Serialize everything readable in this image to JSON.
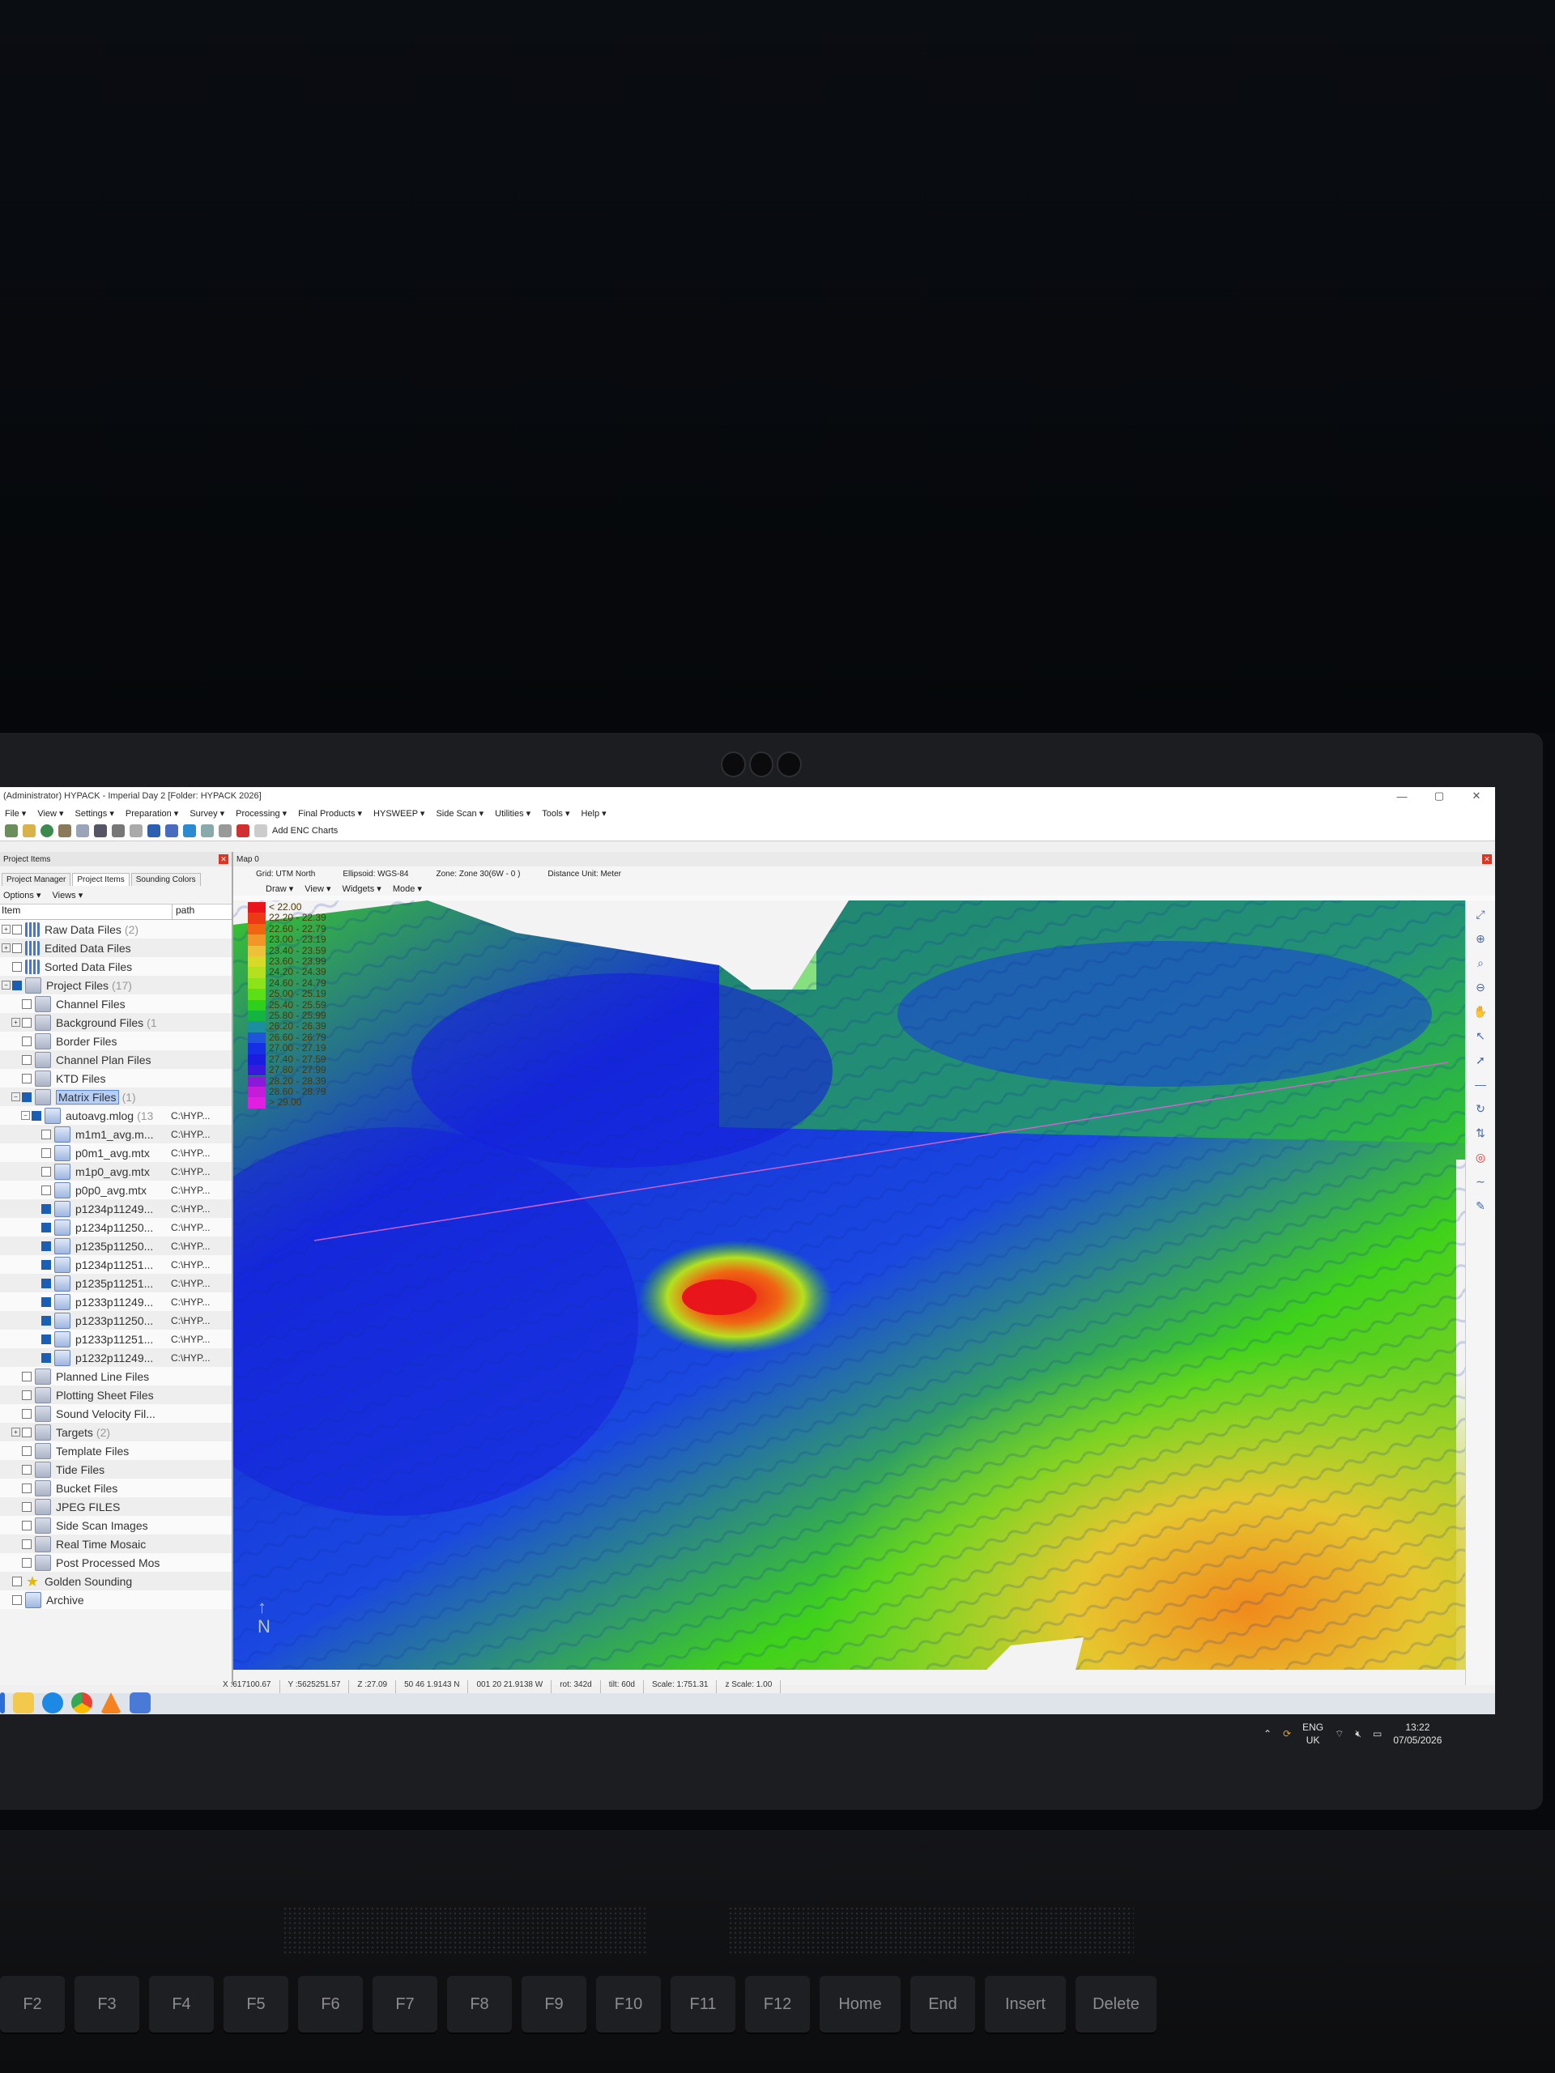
{
  "window": {
    "title": "(Administrator) HYPACK - Imperial Day 2 [Folder: HYPACK 2026]",
    "minimize": "—",
    "maximize": "▢",
    "close": "✕"
  },
  "menu": [
    "File ▾",
    "View ▾",
    "Settings ▾",
    "Preparation ▾",
    "Survey ▾",
    "Processing ▾",
    "Final Products ▾",
    "HYSWEEP ▾",
    "Side Scan ▾",
    "Utilities ▾",
    "Tools ▾",
    "Help ▾"
  ],
  "toolbar": {
    "add_enc": "Add ENC Charts"
  },
  "left_panel": {
    "title": "Project Items",
    "tabs": [
      "Project Manager",
      "Project Items",
      "Sounding Colors"
    ],
    "options": "Options ▾",
    "views": "Views ▾",
    "col_item": "Item",
    "col_path": "path",
    "tree": [
      {
        "name": "Raw Data Files",
        "count": "(2)",
        "level": 0,
        "icon": "grid",
        "exp": "+"
      },
      {
        "name": "Edited Data Files",
        "count": "",
        "level": 0,
        "icon": "grid",
        "exp": "+"
      },
      {
        "name": "Sorted Data Files",
        "count": "",
        "level": 0,
        "icon": "grid",
        "exp": ""
      },
      {
        "name": "Project Files",
        "count": "(17)",
        "level": 0,
        "icon": "folder",
        "exp": "−",
        "checked": true
      },
      {
        "name": "Channel Files",
        "count": "",
        "level": 1,
        "icon": "folder",
        "exp": ""
      },
      {
        "name": "Background Files",
        "count": "(1",
        "level": 1,
        "icon": "folder",
        "exp": "+"
      },
      {
        "name": "Border Files",
        "count": "",
        "level": 1,
        "icon": "folder",
        "exp": ""
      },
      {
        "name": "Channel Plan Files",
        "count": "",
        "level": 1,
        "icon": "folder",
        "exp": ""
      },
      {
        "name": "KTD Files",
        "count": "",
        "level": 1,
        "icon": "folder",
        "exp": ""
      },
      {
        "name": "Matrix Files",
        "count": "(1)",
        "level": 1,
        "icon": "folder",
        "exp": "−",
        "checked": true,
        "selected": true
      },
      {
        "name": "autoavg.mlog",
        "count": "(13",
        "level": 2,
        "icon": "file",
        "exp": "−",
        "checked": true,
        "path": "C:\\HYP..."
      },
      {
        "name": "m1m1_avg.m...",
        "count": "",
        "level": 3,
        "icon": "file",
        "exp": "",
        "path": "C:\\HYP..."
      },
      {
        "name": "p0m1_avg.mtx",
        "count": "",
        "level": 3,
        "icon": "file",
        "exp": "",
        "path": "C:\\HYP..."
      },
      {
        "name": "m1p0_avg.mtx",
        "count": "",
        "level": 3,
        "icon": "file",
        "exp": "",
        "path": "C:\\HYP..."
      },
      {
        "name": "p0p0_avg.mtx",
        "count": "",
        "level": 3,
        "icon": "file",
        "exp": "",
        "path": "C:\\HYP..."
      },
      {
        "name": "p1234p11249...",
        "count": "",
        "level": 3,
        "icon": "file",
        "exp": "",
        "checked": true,
        "path": "C:\\HYP..."
      },
      {
        "name": "p1234p11250...",
        "count": "",
        "level": 3,
        "icon": "file",
        "exp": "",
        "checked": true,
        "path": "C:\\HYP..."
      },
      {
        "name": "p1235p11250...",
        "count": "",
        "level": 3,
        "icon": "file",
        "exp": "",
        "checked": true,
        "path": "C:\\HYP..."
      },
      {
        "name": "p1234p11251...",
        "count": "",
        "level": 3,
        "icon": "file",
        "exp": "",
        "checked": true,
        "path": "C:\\HYP..."
      },
      {
        "name": "p1235p11251...",
        "count": "",
        "level": 3,
        "icon": "file",
        "exp": "",
        "checked": true,
        "path": "C:\\HYP..."
      },
      {
        "name": "p1233p11249...",
        "count": "",
        "level": 3,
        "icon": "file",
        "exp": "",
        "checked": true,
        "path": "C:\\HYP..."
      },
      {
        "name": "p1233p11250...",
        "count": "",
        "level": 3,
        "icon": "file",
        "exp": "",
        "checked": true,
        "path": "C:\\HYP..."
      },
      {
        "name": "p1233p11251...",
        "count": "",
        "level": 3,
        "icon": "file",
        "exp": "",
        "checked": true,
        "path": "C:\\HYP..."
      },
      {
        "name": "p1232p11249...",
        "count": "",
        "level": 3,
        "icon": "file",
        "exp": "",
        "checked": true,
        "path": "C:\\HYP..."
      },
      {
        "name": "Planned Line Files",
        "count": "",
        "level": 1,
        "icon": "folder",
        "exp": ""
      },
      {
        "name": "Plotting Sheet Files",
        "count": "",
        "level": 1,
        "icon": "folder",
        "exp": ""
      },
      {
        "name": "Sound Velocity Fil...",
        "count": "",
        "level": 1,
        "icon": "folder",
        "exp": ""
      },
      {
        "name": "Targets",
        "count": "(2)",
        "level": 1,
        "icon": "folder",
        "exp": "+"
      },
      {
        "name": "Template Files",
        "count": "",
        "level": 1,
        "icon": "folder",
        "exp": ""
      },
      {
        "name": "Tide Files",
        "count": "",
        "level": 1,
        "icon": "folder",
        "exp": ""
      },
      {
        "name": "Bucket Files",
        "count": "",
        "level": 1,
        "icon": "folder",
        "exp": ""
      },
      {
        "name": "JPEG FILES",
        "count": "",
        "level": 1,
        "icon": "folder",
        "exp": ""
      },
      {
        "name": "Side Scan Images",
        "count": "",
        "level": 1,
        "icon": "folder",
        "exp": ""
      },
      {
        "name": "Real Time Mosaic",
        "count": "",
        "level": 1,
        "icon": "folder",
        "exp": ""
      },
      {
        "name": "Post Processed Mos",
        "count": "",
        "level": 1,
        "icon": "folder",
        "exp": ""
      },
      {
        "name": "Golden Sounding",
        "count": "",
        "level": 0,
        "icon": "star",
        "exp": ""
      },
      {
        "name": "Archive",
        "count": "",
        "level": 0,
        "icon": "file",
        "exp": ""
      }
    ]
  },
  "map": {
    "tab": "Map 0",
    "info": [
      "Grid: UTM North",
      "Ellipsoid: WGS-84",
      "Zone: Zone 30(6W - 0 )",
      "Distance Unit: Meter"
    ],
    "menu": [
      "Draw ▾",
      "View ▾",
      "Widgets ▾",
      "Mode ▾"
    ],
    "north": "N",
    "legend": [
      {
        "label": "< 22.00",
        "color": "#e8151b"
      },
      {
        "label": "22.20 - 22.39",
        "color": "#ec3a14"
      },
      {
        "label": "22.60 - 22.79",
        "color": "#f06512"
      },
      {
        "label": "23.00 - 23.19",
        "color": "#f2962a"
      },
      {
        "label": "23.40 - 23.59",
        "color": "#eec13a"
      },
      {
        "label": "23.60 - 23.99",
        "color": "#d8da2a"
      },
      {
        "label": "24.20 - 24.39",
        "color": "#b5e01f"
      },
      {
        "label": "24.60 - 24.79",
        "color": "#8ce31a"
      },
      {
        "label": "25.00 - 25.19",
        "color": "#5ddf18"
      },
      {
        "label": "25.40 - 25.59",
        "color": "#2ed01c"
      },
      {
        "label": "25.80 - 25.99",
        "color": "#14b440"
      },
      {
        "label": "26.20 - 26.39",
        "color": "#1b8fa0"
      },
      {
        "label": "26.60 - 26.79",
        "color": "#1f55d8"
      },
      {
        "label": "27.00 - 27.19",
        "color": "#1530e4"
      },
      {
        "label": "27.40 - 27.59",
        "color": "#1a1ce0"
      },
      {
        "label": "27.80 - 27.99",
        "color": "#3a18dc"
      },
      {
        "label": "28.20 - 28.39",
        "color": "#8a1ad8"
      },
      {
        "label": "28.60 - 28.79",
        "color": "#c41cd8"
      },
      {
        "label": "> 29.00",
        "color": "#e11fe0"
      }
    ]
  },
  "status": [
    "X :617100.67",
    "Y :5625251.57",
    "Z :27.09",
    "50 46 1.9143 N",
    "001 20 21.9138 W",
    "rot: 342d",
    "tilt: 60d",
    "Scale: 1:751.31",
    "z Scale: 1.00"
  ],
  "tray": {
    "lang1": "ENG",
    "lang2": "UK",
    "time": "13:22",
    "date": "07/05/2026"
  },
  "keyboard": [
    "F2",
    "F3",
    "F4",
    "F5",
    "F6",
    "F7",
    "F8",
    "F9",
    "F10",
    "F11",
    "F12",
    "Home",
    "End",
    "Insert",
    "Delete"
  ]
}
